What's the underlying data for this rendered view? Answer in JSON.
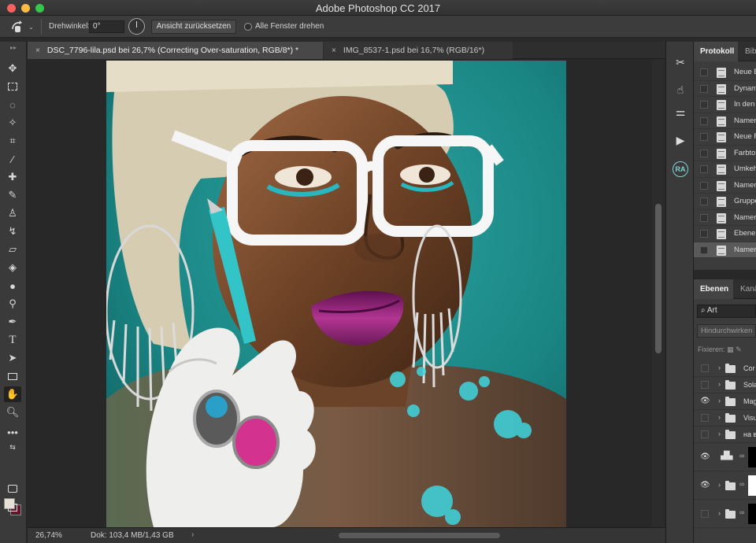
{
  "window": {
    "title": "Adobe Photoshop CC 2017"
  },
  "options_bar": {
    "rotation_label": "Drehwinkel:",
    "rotation_value": "0°",
    "reset_view_label": "Ansicht zurücksetzen",
    "rotate_all_label": "Alle Fenster drehen"
  },
  "tabs": [
    {
      "label": "DSC_7796-lila.psd bei 26,7% (Correcting Over-saturation, RGB/8*) *",
      "close": "×"
    },
    {
      "label": "IMG_8537-1.psd bei 16,7% (RGB/16*)",
      "close": "×"
    }
  ],
  "status": {
    "zoom": "26,74%",
    "doc_info": "Dok: 103,4 MB/1,43 GB",
    "arrow": "›"
  },
  "history_panel": {
    "tabs": [
      "Protokoll",
      "Bib"
    ],
    "items": [
      "Neue Ebene",
      "Dynamik",
      "In den Vordergrund",
      "Namen ändern",
      "Neue Füllebene",
      "Farbton/Sättigung",
      "Umkehren",
      "Namen ändern",
      "Gruppe aus Ebenen",
      "Namen ändern",
      "Ebenen",
      "Namen ändern"
    ]
  },
  "layers_panel": {
    "tabs": [
      "Ebenen",
      "Kanä"
    ],
    "search_value": "Art",
    "blend_mode": "Hindurchwirken",
    "lock_label": "Fixieren:",
    "layers": [
      {
        "name": "Cor",
        "visible": false
      },
      {
        "name": "Sola",
        "visible": false
      },
      {
        "name": "Mag",
        "visible": true
      },
      {
        "name": "Visu",
        "visible": false
      },
      {
        "name": "на в",
        "visible": false
      }
    ]
  },
  "icon_column": {
    "ra_label": "RA"
  },
  "colors": {
    "accent_ra": "#7fd3d3",
    "foreground_swatch": "#e8e0d4",
    "background_swatch": "#5a1a2a",
    "photo_backdrop": "#1f8e8c",
    "lipstick": "#8a1f6a"
  }
}
